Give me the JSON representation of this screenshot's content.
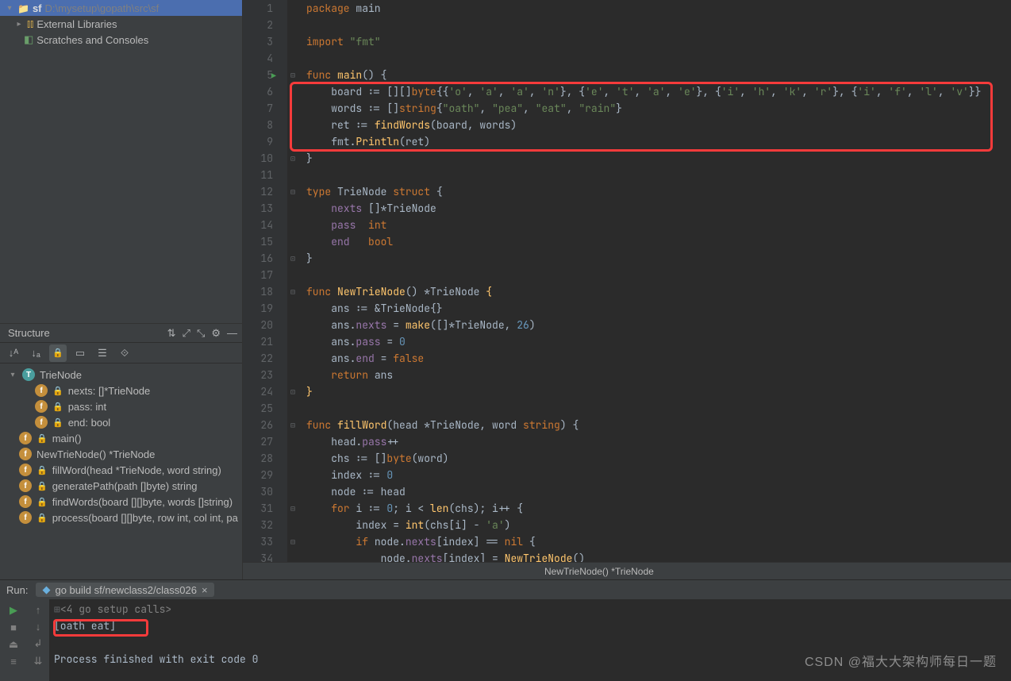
{
  "project": {
    "root_name": "sf",
    "root_path": "D:\\mysetup\\gopath\\src\\sf",
    "external_libs": "External Libraries",
    "scratches": "Scratches and Consoles"
  },
  "structure": {
    "title": "Structure",
    "tree": {
      "type_node": "TrieNode",
      "field1": "nexts: []*TrieNode",
      "field2": "pass: int",
      "field3": "end: bool",
      "fn_main": "main()",
      "fn_new": "NewTrieNode() *TrieNode",
      "fn_fill": "fillWord(head *TrieNode, word string)",
      "fn_gen": "generatePath(path []byte) string",
      "fn_find": "findWords(board [][]byte, words []string)",
      "fn_proc": "process(board [][]byte, row int, col int, pa"
    }
  },
  "code": {
    "breadcrumb": "NewTrieNode() *TrieNode",
    "lines": [
      {
        "n": 1,
        "raw": "package main",
        "seg": [
          [
            "kw",
            "package "
          ],
          [
            "pkg",
            "main"
          ]
        ]
      },
      {
        "n": 2,
        "raw": "",
        "seg": []
      },
      {
        "n": 3,
        "raw": "import \"fmt\"",
        "seg": [
          [
            "kw",
            "import "
          ],
          [
            "str",
            "\"fmt\""
          ]
        ]
      },
      {
        "n": 4,
        "raw": "",
        "seg": []
      },
      {
        "n": 5,
        "raw": "func main() {",
        "seg": [
          [
            "kw",
            "func "
          ],
          [
            "fn",
            "main"
          ],
          [
            "op",
            "() {"
          ]
        ]
      },
      {
        "n": 6,
        "raw": "    board := [][]byte{{'o', 'a', 'a', 'n'}, {'e', 't', 'a', 'e'}, {'i', 'h', 'k', 'r'}, {'i', 'f', 'l', 'v'}}",
        "seg": [
          [
            "ident",
            "    board "
          ],
          [
            "op",
            ":= [][]"
          ],
          [
            "kw",
            "byte"
          ],
          [
            "op",
            "{{"
          ],
          [
            "str",
            "'o'"
          ],
          [
            "op",
            ", "
          ],
          [
            "str",
            "'a'"
          ],
          [
            "op",
            ", "
          ],
          [
            "str",
            "'a'"
          ],
          [
            "op",
            ", "
          ],
          [
            "str",
            "'n'"
          ],
          [
            "op",
            "}, {"
          ],
          [
            "str",
            "'e'"
          ],
          [
            "op",
            ", "
          ],
          [
            "str",
            "'t'"
          ],
          [
            "op",
            ", "
          ],
          [
            "str",
            "'a'"
          ],
          [
            "op",
            ", "
          ],
          [
            "str",
            "'e'"
          ],
          [
            "op",
            "}, {"
          ],
          [
            "str",
            "'i'"
          ],
          [
            "op",
            ", "
          ],
          [
            "str",
            "'h'"
          ],
          [
            "op",
            ", "
          ],
          [
            "str",
            "'k'"
          ],
          [
            "op",
            ", "
          ],
          [
            "str",
            "'r'"
          ],
          [
            "op",
            "}, {"
          ],
          [
            "str",
            "'i'"
          ],
          [
            "op",
            ", "
          ],
          [
            "str",
            "'f'"
          ],
          [
            "op",
            ", "
          ],
          [
            "str",
            "'l'"
          ],
          [
            "op",
            ", "
          ],
          [
            "str",
            "'v'"
          ],
          [
            "op",
            "}}"
          ]
        ]
      },
      {
        "n": 7,
        "raw": "    words := []string{\"oath\", \"pea\", \"eat\", \"rain\"}",
        "seg": [
          [
            "ident",
            "    words "
          ],
          [
            "op",
            ":= []"
          ],
          [
            "kw",
            "string"
          ],
          [
            "op",
            "{"
          ],
          [
            "str",
            "\"oath\""
          ],
          [
            "op",
            ", "
          ],
          [
            "str",
            "\"pea\""
          ],
          [
            "op",
            ", "
          ],
          [
            "str",
            "\"eat\""
          ],
          [
            "op",
            ", "
          ],
          [
            "str",
            "\"rain\""
          ],
          [
            "op",
            "}"
          ]
        ]
      },
      {
        "n": 8,
        "raw": "    ret := findWords(board, words)",
        "seg": [
          [
            "ident",
            "    ret "
          ],
          [
            "op",
            ":= "
          ],
          [
            "fn",
            "findWords"
          ],
          [
            "op",
            "(board, words)"
          ]
        ]
      },
      {
        "n": 9,
        "raw": "    fmt.Println(ret)",
        "seg": [
          [
            "ident",
            "    fmt."
          ],
          [
            "fn",
            "Println"
          ],
          [
            "op",
            "(ret)"
          ]
        ]
      },
      {
        "n": 10,
        "raw": "}",
        "seg": [
          [
            "op",
            "}"
          ]
        ]
      },
      {
        "n": 11,
        "raw": "",
        "seg": []
      },
      {
        "n": 12,
        "raw": "type TrieNode struct {",
        "seg": [
          [
            "kw",
            "type "
          ],
          [
            "typ",
            "TrieNode "
          ],
          [
            "kw",
            "struct"
          ],
          [
            "op",
            " {"
          ]
        ]
      },
      {
        "n": 13,
        "raw": "    nexts []*TrieNode",
        "seg": [
          [
            "ident",
            "    "
          ],
          [
            "field",
            "nexts"
          ],
          [
            "ident",
            " []*TrieNode"
          ]
        ]
      },
      {
        "n": 14,
        "raw": "    pass  int",
        "seg": [
          [
            "ident",
            "    "
          ],
          [
            "field",
            "pass"
          ],
          [
            "ident",
            "  "
          ],
          [
            "kw",
            "int"
          ]
        ]
      },
      {
        "n": 15,
        "raw": "    end   bool",
        "seg": [
          [
            "ident",
            "    "
          ],
          [
            "field",
            "end"
          ],
          [
            "ident",
            "   "
          ],
          [
            "kw",
            "bool"
          ]
        ]
      },
      {
        "n": 16,
        "raw": "}",
        "seg": [
          [
            "op",
            "}"
          ]
        ]
      },
      {
        "n": 17,
        "raw": "",
        "seg": []
      },
      {
        "n": 18,
        "raw": "func NewTrieNode() *TrieNode {",
        "seg": [
          [
            "kw",
            "func "
          ],
          [
            "fn",
            "NewTrieNode"
          ],
          [
            "op",
            "() *TrieNode "
          ],
          [
            "fn",
            "{"
          ]
        ]
      },
      {
        "n": 19,
        "raw": "    ans := &TrieNode{}",
        "seg": [
          [
            "ident",
            "    ans "
          ],
          [
            "op",
            ":= &TrieNode{}"
          ]
        ]
      },
      {
        "n": 20,
        "raw": "    ans.nexts = make([]*TrieNode, 26)",
        "seg": [
          [
            "ident",
            "    ans."
          ],
          [
            "field",
            "nexts"
          ],
          [
            "op",
            " = "
          ],
          [
            "fn",
            "make"
          ],
          [
            "op",
            "([]*TrieNode, "
          ],
          [
            "num",
            "26"
          ],
          [
            "op",
            ")"
          ]
        ]
      },
      {
        "n": 21,
        "raw": "    ans.pass = 0",
        "seg": [
          [
            "ident",
            "    ans."
          ],
          [
            "field",
            "pass"
          ],
          [
            "op",
            " = "
          ],
          [
            "num",
            "0"
          ]
        ]
      },
      {
        "n": 22,
        "raw": "    ans.end = false",
        "seg": [
          [
            "ident",
            "    ans."
          ],
          [
            "field",
            "end"
          ],
          [
            "op",
            " = "
          ],
          [
            "lit",
            "false"
          ]
        ]
      },
      {
        "n": 23,
        "raw": "    return ans",
        "seg": [
          [
            "ident",
            "    "
          ],
          [
            "kw",
            "return"
          ],
          [
            "ident",
            " ans"
          ]
        ]
      },
      {
        "n": 24,
        "raw": "}",
        "seg": [
          [
            "fn",
            "}"
          ]
        ]
      },
      {
        "n": 25,
        "raw": "",
        "seg": []
      },
      {
        "n": 26,
        "raw": "func fillWord(head *TrieNode, word string) {",
        "seg": [
          [
            "kw",
            "func "
          ],
          [
            "fn",
            "fillWord"
          ],
          [
            "op",
            "(head *TrieNode, word "
          ],
          [
            "kw",
            "string"
          ],
          [
            "op",
            ") {"
          ]
        ]
      },
      {
        "n": 27,
        "raw": "    head.pass++",
        "seg": [
          [
            "ident",
            "    head."
          ],
          [
            "field",
            "pass"
          ],
          [
            "op",
            "++"
          ]
        ]
      },
      {
        "n": 28,
        "raw": "    chs := []byte(word)",
        "seg": [
          [
            "ident",
            "    chs "
          ],
          [
            "op",
            ":= []"
          ],
          [
            "kw",
            "byte"
          ],
          [
            "op",
            "(word)"
          ]
        ]
      },
      {
        "n": 29,
        "raw": "    index := 0",
        "seg": [
          [
            "ident",
            "    index "
          ],
          [
            "op",
            ":= "
          ],
          [
            "num",
            "0"
          ]
        ]
      },
      {
        "n": 30,
        "raw": "    node := head",
        "seg": [
          [
            "ident",
            "    node "
          ],
          [
            "op",
            ":= head"
          ]
        ]
      },
      {
        "n": 31,
        "raw": "    for i := 0; i < len(chs); i++ {",
        "seg": [
          [
            "ident",
            "    "
          ],
          [
            "kw",
            "for"
          ],
          [
            "ident",
            " i "
          ],
          [
            "op",
            ":= "
          ],
          [
            "num",
            "0"
          ],
          [
            "op",
            "; i < "
          ],
          [
            "fn",
            "len"
          ],
          [
            "op",
            "(chs); i++ {"
          ]
        ]
      },
      {
        "n": 32,
        "raw": "        index = int(chs[i] - 'a')",
        "seg": [
          [
            "ident",
            "        index = "
          ],
          [
            "fn",
            "int"
          ],
          [
            "op",
            "(chs[i] - "
          ],
          [
            "str",
            "'a'"
          ],
          [
            "op",
            ")"
          ]
        ]
      },
      {
        "n": 33,
        "raw": "        if node.nexts[index] == nil {",
        "seg": [
          [
            "ident",
            "        "
          ],
          [
            "kw",
            "if"
          ],
          [
            "ident",
            " node."
          ],
          [
            "field",
            "nexts"
          ],
          [
            "op",
            "[index] == "
          ],
          [
            "lit",
            "nil"
          ],
          [
            "op",
            " {"
          ]
        ]
      },
      {
        "n": 34,
        "raw": "            node.nexts[index] = NewTrieNode()",
        "seg": [
          [
            "ident",
            "            node."
          ],
          [
            "field",
            "nexts"
          ],
          [
            "op",
            "[index] = "
          ],
          [
            "fn",
            "NewTrieNode"
          ],
          [
            "op",
            "()"
          ]
        ]
      }
    ]
  },
  "run": {
    "label": "Run:",
    "tab": "go build sf/newclass2/class026",
    "out1": "<4 go setup calls>",
    "out2": "[oath eat]",
    "out3": "Process finished with exit code 0"
  },
  "watermark": "CSDN @福大大架构师每日一题"
}
